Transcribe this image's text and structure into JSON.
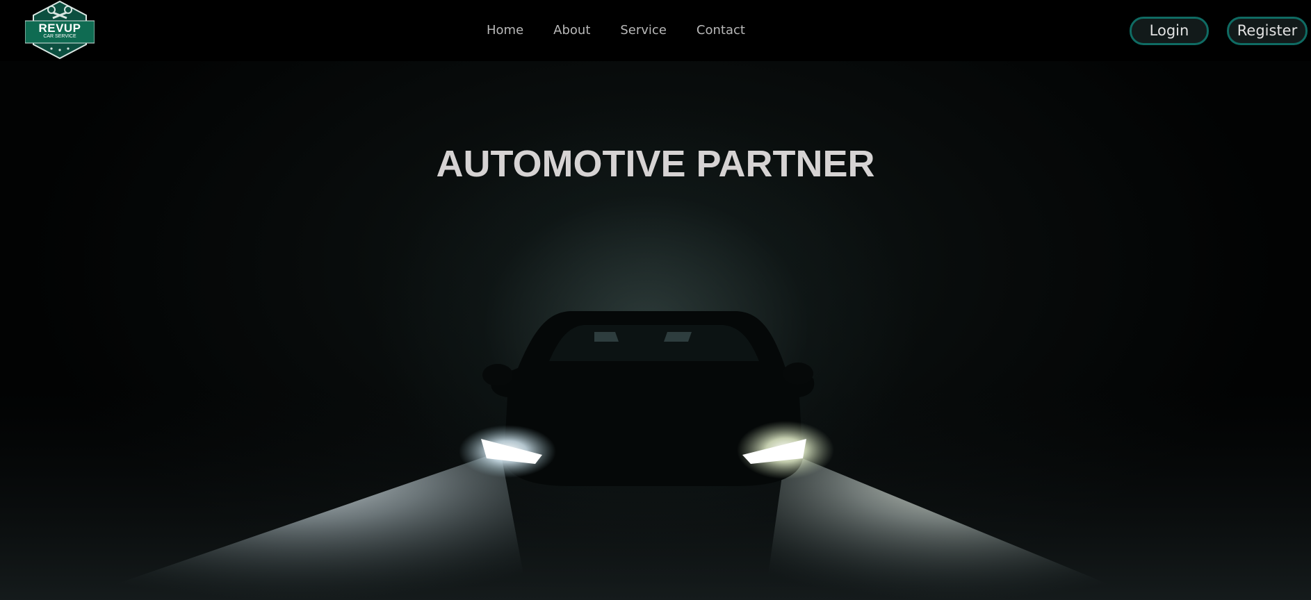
{
  "logo": {
    "main": "REVUP",
    "sub": "CAR SERVICE",
    "color": "#0f6b52"
  },
  "nav": {
    "items": [
      {
        "label": "Home"
      },
      {
        "label": "About"
      },
      {
        "label": "Service"
      },
      {
        "label": "Contact"
      }
    ]
  },
  "auth": {
    "login_label": "Login",
    "register_label": "Register",
    "accent": "#0f6b63"
  },
  "hero": {
    "title": "AUTOMOTIVE PARTNER"
  }
}
